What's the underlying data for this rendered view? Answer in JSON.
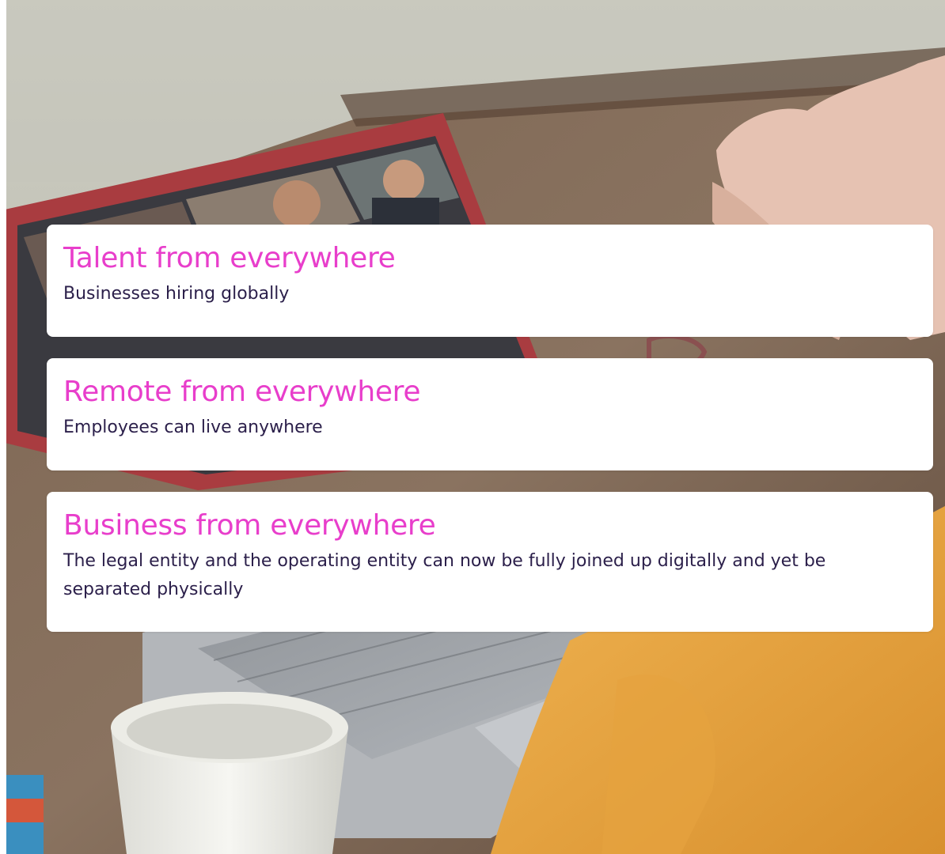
{
  "cards": [
    {
      "title": "Talent from everywhere",
      "description": "Businesses hiring globally"
    },
    {
      "title": "Remote from everywhere",
      "description": "Employees can live anywhere"
    },
    {
      "title": "Business from everywhere",
      "description": "The legal entity and the operating entity can now be fully joined up digitally and yet be separated physically"
    }
  ],
  "colors": {
    "title": "#e83ecb",
    "body_text": "#2b1f4a",
    "card_background": "#ffffff"
  }
}
